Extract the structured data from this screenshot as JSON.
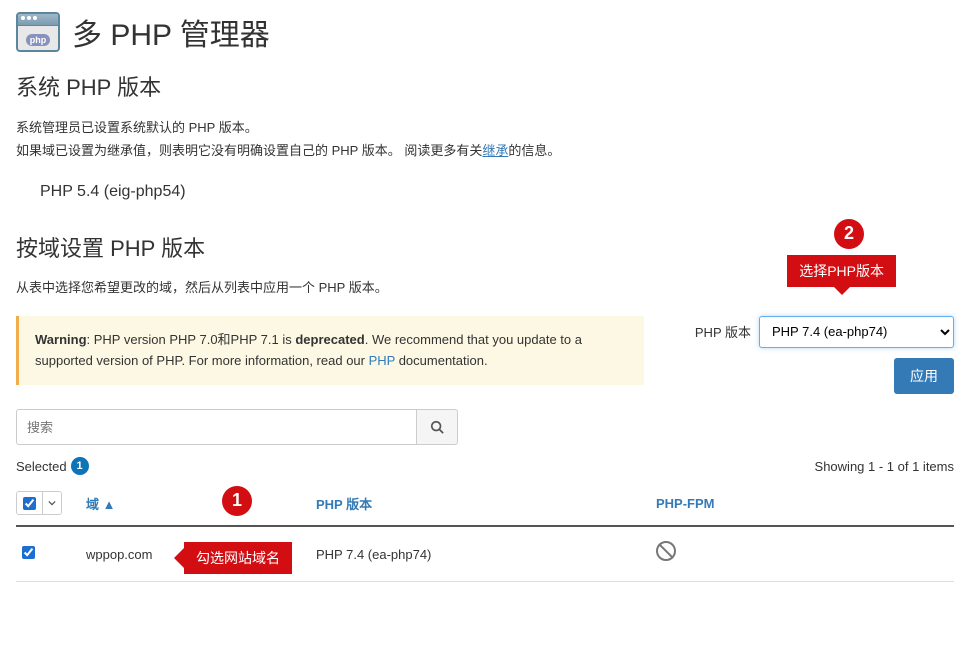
{
  "header": {
    "title": "多 PHP 管理器"
  },
  "system": {
    "heading": "系统 PHP 版本",
    "desc_line1": "系统管理员已设置系统默认的 PHP 版本。",
    "desc_line2_pre": "如果域已设置为继承值，则表明它没有明确设置自己的 PHP 版本。 阅读更多有关",
    "desc_link": "继承",
    "desc_line2_post": "的信息。",
    "current": "PHP 5.4 (eig-php54)"
  },
  "domain_section": {
    "heading": "按域设置 PHP 版本",
    "desc": "从表中选择您希望更改的域，然后从列表中应用一个 PHP 版本。",
    "warning_label": "Warning",
    "warning_text_pre": ": PHP version PHP 7.0和PHP 7.1 is ",
    "warning_deprecated": "deprecated",
    "warning_text_mid": ". We recommend that you update to a supported version of PHP. For more information, read our ",
    "warning_link": "PHP",
    "warning_text_post": " documentation.",
    "search_placeholder": "搜索",
    "selected_label": "Selected",
    "selected_count": "1",
    "showing": "Showing 1 - 1 of 1 items",
    "php_ver_label": "PHP 版本",
    "apply_label": "应用",
    "select_value": "PHP 7.4 (ea-php74)"
  },
  "columns": {
    "domain": "域 ▲",
    "version": "PHP 版本",
    "fpm": "PHP-FPM"
  },
  "rows": [
    {
      "domain": "wppop.com",
      "version": "PHP 7.4 (ea-php74)"
    }
  ],
  "annotations": {
    "step1": "1",
    "step1_tag": "勾选网站域名",
    "step2": "2",
    "step2_tag": "选择PHP版本"
  }
}
